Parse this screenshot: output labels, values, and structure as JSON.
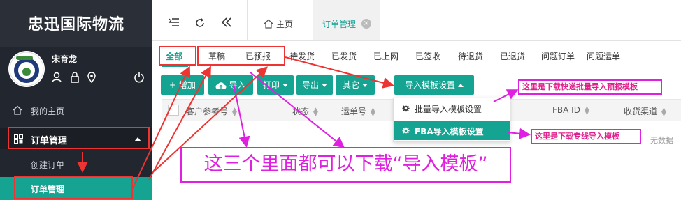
{
  "brand": {
    "title": "忠迅国际物流"
  },
  "user": {
    "name": "宋育龙"
  },
  "sidebar": {
    "home": "我的主页",
    "order_mgmt": "订单管理",
    "create_order": "创建订单",
    "order_mgmt_sub": "订单管理"
  },
  "tabs": {
    "home": "主页",
    "order": "订单管理",
    "close": "×"
  },
  "status_tabs": [
    "全部",
    "草稿",
    "已预报",
    "待发货",
    "已发货",
    "已上网",
    "已签收",
    "待退货",
    "已退货",
    "问题订单",
    "问题运单"
  ],
  "toolbar": {
    "add": "增加",
    "import": "导入",
    "print": "打印",
    "export": "导出",
    "other": "其它",
    "template_settings": "导入模板设置"
  },
  "table": {
    "headers": [
      "客户参考号",
      "状态",
      "运单号",
      "FBA ID",
      "收货渠道"
    ],
    "empty": "无数据"
  },
  "template_menu": {
    "item1": "批量导入模板设置",
    "item2": "FBA导入模板设置"
  },
  "annotations": {
    "callout1": "这里是下载快递批量导入预报模板",
    "callout2": "这里是下载专线导入模板",
    "big": "这三个里面都可以下载“导入模板”"
  },
  "colors": {
    "accent": "#15a392",
    "sidebar": "#22262e",
    "annotation_red": "#e33333",
    "annotation_magenta": "#e020e0"
  }
}
